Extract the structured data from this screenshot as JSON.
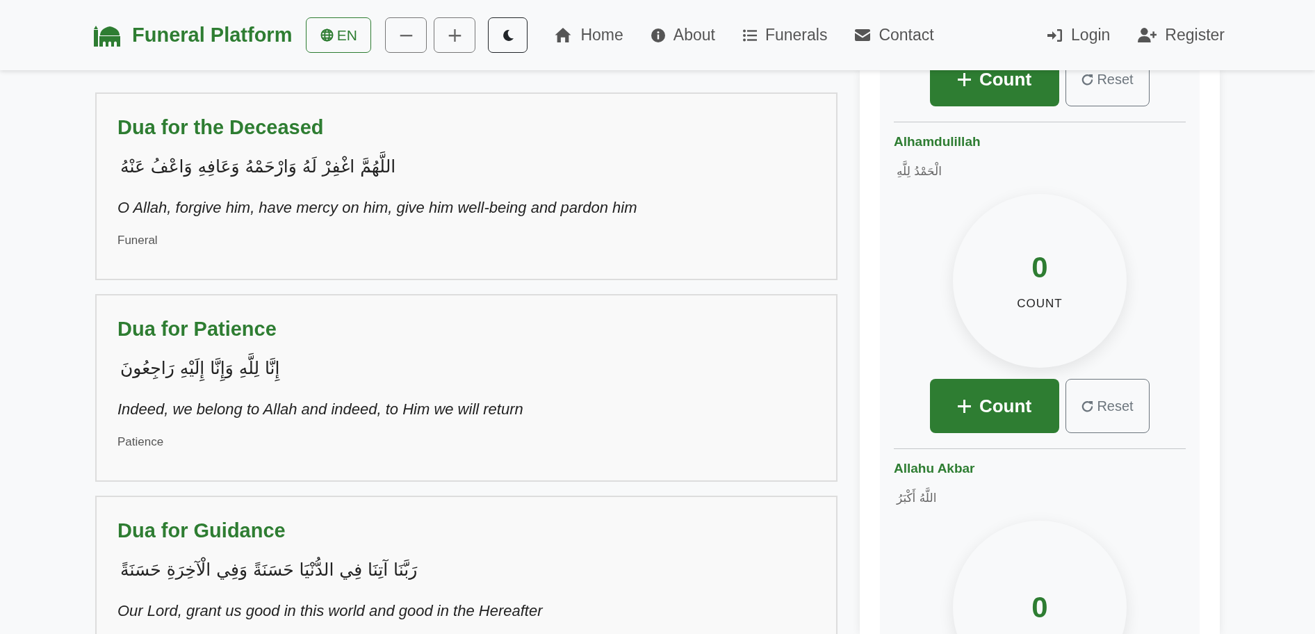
{
  "navbar": {
    "brand": "Funeral Platform",
    "language": "EN",
    "font_decrease": "−",
    "font_increase": "+",
    "links": [
      {
        "label": "Home",
        "kind": "home"
      },
      {
        "label": "About",
        "kind": "info"
      },
      {
        "label": "Funerals",
        "kind": "list"
      },
      {
        "label": "Contact",
        "kind": "mail"
      }
    ],
    "auth": [
      {
        "label": "Login",
        "kind": "login"
      },
      {
        "label": "Register",
        "kind": "register"
      }
    ]
  },
  "duas": [
    {
      "title": "Dua for the Deceased",
      "arabic": "اللَّهُمَّ اغْفِرْ لَهُ وَارْحَمْهُ وَعَافِهِ وَاعْفُ عَنْهُ",
      "translation": "O Allah, forgive him, have mercy on him, give him well-being and pardon him",
      "category": "Funeral"
    },
    {
      "title": "Dua for Patience",
      "arabic": "إِنَّا لِلَّهِ وَإِنَّا إِلَيْهِ رَاجِعُونَ",
      "translation": "Indeed, we belong to Allah and indeed, to Him we will return",
      "category": "Patience"
    },
    {
      "title": "Dua for Guidance",
      "arabic": "رَبَّنَا آتِنَا فِي الدُّنْيَا حَسَنَةً وَفِي الْآخِرَةِ حَسَنَةً",
      "translation": "Our Lord, grant us good in this world and good in the Hereafter"
    }
  ],
  "counters": [
    {
      "count_button": "Count",
      "reset_button": "Reset"
    },
    {
      "title": "Alhamdulillah",
      "arabic": "الْحَمْدُ لِلَّهِ",
      "count": "0",
      "count_label": "COUNT",
      "count_button": "Count",
      "reset_button": "Reset"
    },
    {
      "title": "Allahu Akbar",
      "arabic": "اللَّهُ أَكْبَرُ",
      "count": "0"
    }
  ]
}
